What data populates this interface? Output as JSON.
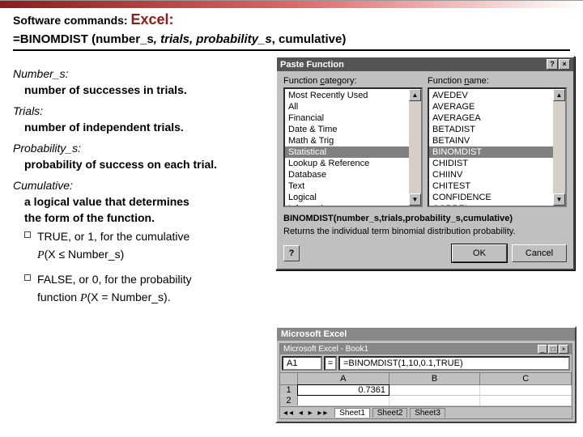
{
  "header": {
    "prefix": "Software commands:",
    "tool": "Excel:",
    "formula": "=BINOMDIST (number_s",
    "formula_rest": ", trials, probability_s",
    "formula_tail": ", cumulative)"
  },
  "params": {
    "number_s": {
      "label": "Number_s:",
      "desc": "number of successes in trials."
    },
    "trials": {
      "label": "Trials:",
      "desc": "number of independent trials."
    },
    "prob_s": {
      "label": "Probability_s:",
      "desc": "probability of success on each trial."
    },
    "cumul": {
      "label": "Cumulative:",
      "desc1": "a logical value that determines",
      "desc2": "the form of the function."
    }
  },
  "bullets": {
    "true": {
      "lead": "TRUE, or 1, for the cumulative",
      "math_pre": "P",
      "math_mid": "(X ≤ Number_s)"
    },
    "false": {
      "lead": "FALSE, or 0, for the probability",
      "line2_pre": "function ",
      "math_pre": "P",
      "math_mid": "(X = Number_s)."
    }
  },
  "dialog": {
    "title": "Paste Function",
    "btn_help": "?",
    "btn_close": "×",
    "cat_label_pre": "Function ",
    "cat_label_u": "c",
    "cat_label_post": "ategory:",
    "name_label_pre": "Function ",
    "name_label_u": "n",
    "name_label_post": "ame:",
    "categories": [
      "Most Recently Used",
      "All",
      "Financial",
      "Date & Time",
      "Math & Trig",
      "Statistical",
      "Lookup & Reference",
      "Database",
      "Text",
      "Logical",
      "Information"
    ],
    "cat_selected_index": 5,
    "functions": [
      "AVEDEV",
      "AVERAGE",
      "AVERAGEA",
      "BETADIST",
      "BETAINV",
      "BINOMDIST",
      "CHIDIST",
      "CHIINV",
      "CHITEST",
      "CONFIDENCE",
      "CORREL"
    ],
    "fn_selected_index": 5,
    "signature": "BINOMDIST(number_s,trials,probability_s,cumulative)",
    "description": "Returns the individual term binomial distribution probability.",
    "ok": "OK",
    "cancel": "Cancel",
    "help_icon": "?"
  },
  "excel": {
    "app_title": "Microsoft Excel",
    "book_title": "Microsoft Excel - Book1",
    "namebox": "A1",
    "formula": "=BINOMDIST(1,10,0.1,TRUE)",
    "eq": "=",
    "columns": [
      "A",
      "B",
      "C"
    ],
    "rows": [
      "1",
      "2"
    ],
    "result_cell": "0.7361",
    "sheets": {
      "arrows": "◂◂ ◂ ▸ ▸▸",
      "s1": "Sheet1",
      "s2": "Sheet2",
      "s3": "Sheet3"
    }
  }
}
